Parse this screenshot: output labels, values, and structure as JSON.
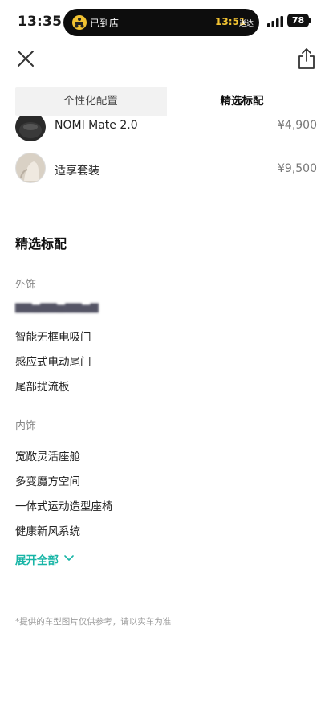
{
  "status_bar": {
    "time": "13:35",
    "island": {
      "left_text": "已到店",
      "right_time": "13:51",
      "right_text": "送达"
    },
    "battery": "78"
  },
  "tabs": [
    {
      "label": "个性化配置",
      "active": false
    },
    {
      "label": "精选标配",
      "active": true
    }
  ],
  "items": [
    {
      "name": "NOMI Mate 2.0",
      "price": "¥4,900",
      "icon": "nomi-thumbnail"
    },
    {
      "name": "适享套装",
      "price": "¥9,500",
      "icon": "seat-suit-thumbnail"
    }
  ],
  "section_title": "精选标配",
  "groups": [
    {
      "label": "外饰",
      "features": [
        "智能无框电吸门",
        "感应式电动尾门",
        "尾部扰流板"
      ]
    },
    {
      "label": "内饰",
      "features": [
        "宽敞灵活座舱",
        "多变魔方空间",
        "一体式运动造型座椅",
        "健康新风系统"
      ]
    }
  ],
  "expand_label": "展开全部",
  "disclaimer": "*提供的车型图片仅供参考，请以实车为准",
  "colors": {
    "accent": "#18b5a6",
    "island_time": "#f1c232"
  }
}
